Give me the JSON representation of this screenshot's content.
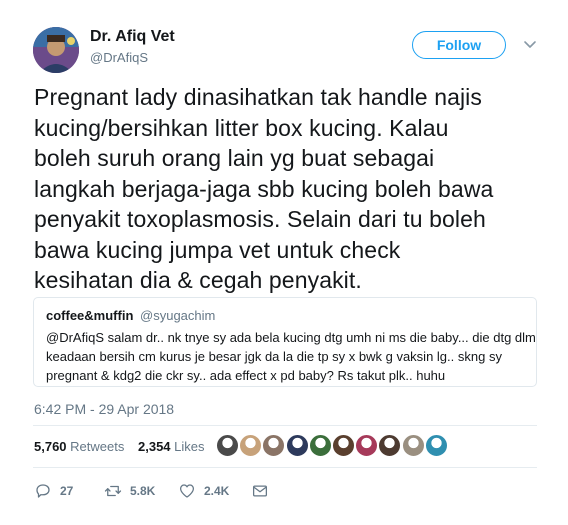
{
  "author": {
    "name": "Dr. Afiq Vet",
    "handle": "@DrAfiqS"
  },
  "follow_label": "Follow",
  "tweet_lines": [
    "Pregnant lady dinasihatkan tak handle najis",
    "kucing/bersihkan litter box kucing. Kalau",
    "boleh suruh orang lain yg buat sebagai",
    "langkah berjaga-jaga sbb kucing boleh bawa",
    "penyakit toxoplasmosis. Selain dari tu boleh",
    "bawa kucing jumpa vet untuk check",
    "kesihatan dia & cegah penyakit."
  ],
  "quoted": {
    "name": "coffee&muffin",
    "handle": "@syugachim",
    "lines": [
      "@DrAfiqS salam dr.. nk tnye sy ada bela kucing dtg umh ni ms die baby... die dtg dlm",
      "keadaan bersih cm kurus je besar jgk da la die tp sy x bwk g vaksin lg.. skng sy",
      "pregnant & kdg2 die ckr sy.. ada effect x pd baby? Rs takut plk.. huhu"
    ]
  },
  "timestamp": "6:42 PM - 29 Apr 2018",
  "stats": {
    "retweets_count": "5,760",
    "retweets_label": "Retweets",
    "likes_count": "2,354",
    "likes_label": "Likes"
  },
  "likers_colors": [
    "#4a4a4a",
    "#c7a27a",
    "#8a7466",
    "#2d3a5c",
    "#3b6e3b",
    "#5a3f2e",
    "#a63a5a",
    "#4d3b31",
    "#9a8f80",
    "#2f8fb0"
  ],
  "actions": {
    "replies": "27",
    "retweets": "5.8K",
    "likes": "2.4K"
  },
  "colors": {
    "accent": "#1da1f2",
    "muted": "#657786",
    "text": "#14171a",
    "border": "#e1e8ed"
  },
  "icons": [
    "profile-avatar",
    "chevron-down-icon",
    "reply-icon",
    "retweet-icon",
    "like-heart-icon",
    "direct-message-icon"
  ]
}
